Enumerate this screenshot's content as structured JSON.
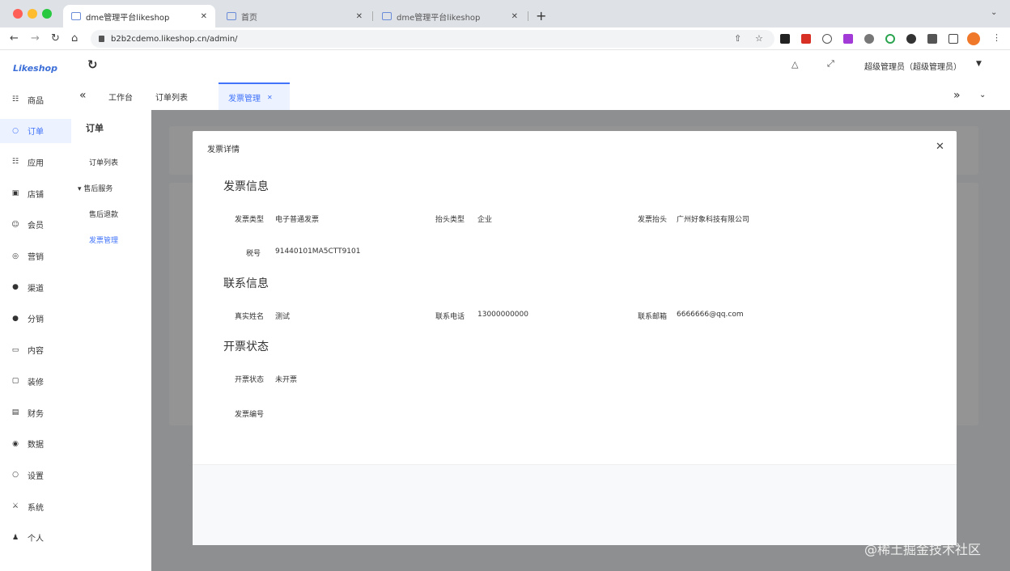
{
  "browser": {
    "tabs": [
      {
        "title": "dme管理平台likeshop",
        "close": "✕"
      },
      {
        "title": "首页",
        "close": "✕"
      },
      {
        "title": "dme管理平台likeshop",
        "close": "✕"
      }
    ],
    "new_tab": "+",
    "tab_menu": "⌄",
    "address": "b2b2cdemo.likeshop.cn/admin/"
  },
  "sidebar": {
    "logo": "Likeshop",
    "items": [
      {
        "icon": "☷",
        "label": "商品"
      },
      {
        "icon": "○",
        "label": "订单"
      },
      {
        "icon": "☷",
        "label": "应用"
      },
      {
        "icon": "▣",
        "label": "店铺"
      },
      {
        "icon": "☺",
        "label": "会员"
      },
      {
        "icon": "◎",
        "label": "营销"
      },
      {
        "icon": "●",
        "label": "渠道"
      },
      {
        "icon": "●",
        "label": "分销"
      },
      {
        "icon": "▭",
        "label": "内容"
      },
      {
        "icon": "▢",
        "label": "装修"
      },
      {
        "icon": "▤",
        "label": "财务"
      },
      {
        "icon": "◉",
        "label": "数据"
      },
      {
        "icon": "○",
        "label": "设置"
      },
      {
        "icon": "⚔",
        "label": "系统"
      },
      {
        "icon": "♟",
        "label": "个人"
      }
    ],
    "active_index": 1
  },
  "header": {
    "refresh_icon": "↻",
    "bell_icon": "△",
    "fullscreen_icon": "⤢",
    "user": "超级管理员（超级管理员）",
    "user_caret": "▼"
  },
  "tabsbar": {
    "collapse": "«",
    "tabs": [
      {
        "label": "工作台"
      },
      {
        "label": "订单列表"
      },
      {
        "label": "发票管理",
        "close": "✕"
      }
    ],
    "more": "»",
    "down": "⌄"
  },
  "submenu": {
    "title": "订单",
    "items": [
      {
        "label": "订单列表"
      },
      {
        "label": "▾ 售后服务"
      },
      {
        "label": "售后退款"
      },
      {
        "label": "发票管理"
      }
    ]
  },
  "dialog": {
    "title": "发票详情",
    "close": "✕",
    "sections": [
      {
        "title": "发票信息",
        "fields": [
          {
            "label": "发票类型",
            "value": "电子普通发票"
          },
          {
            "label": "抬头类型",
            "value": "企业"
          },
          {
            "label": "发票抬头",
            "value": "广州好象科技有限公司"
          },
          {
            "label": "税号",
            "value": "91440101MA5CTT9101"
          }
        ]
      },
      {
        "title": "联系信息",
        "fields": [
          {
            "label": "真实姓名",
            "value": "测试"
          },
          {
            "label": "联系电话",
            "value": "13000000000"
          },
          {
            "label": "联系邮箱",
            "value": "6666666@qq.com"
          }
        ]
      },
      {
        "title": "开票状态",
        "fields": [
          {
            "label": "开票状态",
            "value": "未开票"
          },
          {
            "label": "发票编号",
            "value": ""
          }
        ]
      }
    ]
  },
  "watermark": "@稀土掘金技术社区",
  "colors": {
    "accent": "#4073fa",
    "active_bg": "#ecf2ff",
    "mask": "rgba(0,0,0,0.42)"
  }
}
